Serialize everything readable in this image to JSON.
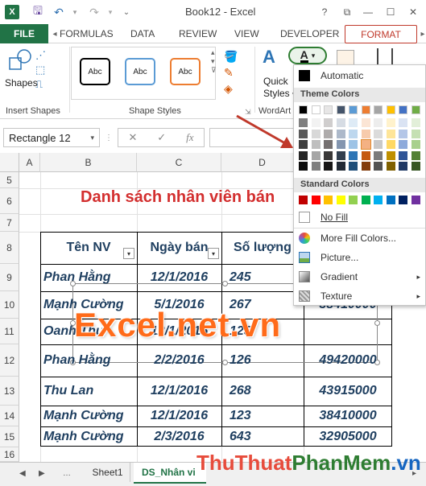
{
  "window": {
    "title": "Book12 - Excel",
    "help": "?",
    "restore": "⧉",
    "minimize": "—",
    "maximize": "☐",
    "close": "✕"
  },
  "quick_access": {
    "save_icon": "save-icon",
    "undo_icon": "undo-icon",
    "redo_icon": "redo-icon"
  },
  "tabs": {
    "file": "FILE",
    "formulas": "FORMULAS",
    "data": "DATA",
    "review": "REVIEW",
    "view": "VIEW",
    "developer": "DEVELOPER",
    "format": "FORMAT"
  },
  "ribbon": {
    "shapes_label": "Shapes",
    "insert_shapes_label": "Insert Shapes",
    "shape_style_sample": "Abc",
    "shape_styles_label": "Shape Styles",
    "quick_styles_line1": "Quick",
    "quick_styles_line2": "Styles",
    "wordart_label": "WordArt",
    "text_fill_letter": "A",
    "colors": {
      "style1": "#000000",
      "style2": "#5b9bd5",
      "style3": "#ed7d31"
    }
  },
  "formula_bar": {
    "name_box": "Rectangle 12",
    "cancel": "✕",
    "enter": "✓",
    "fx": "fx"
  },
  "grid": {
    "columns": [
      "A",
      "B",
      "C",
      "D"
    ],
    "rows": [
      "5",
      "6",
      "7",
      "8",
      "9",
      "10",
      "11",
      "12",
      "13",
      "14",
      "15",
      "16"
    ],
    "title": "Danh sách nhân viên bán",
    "headers": [
      "Tên NV",
      "Ngày bán",
      "Số lượng"
    ],
    "data_rows": [
      {
        "name": "Phan Hằng",
        "date": "12/1/2016",
        "qty": "245",
        "amount": ""
      },
      {
        "name": "Mạnh Cường",
        "date": "5/1/2016",
        "qty": "267",
        "amount": "38410000"
      },
      {
        "name": "Oanh Thu",
        "date": "12/1/2016",
        "qty": "125",
        "amount": ""
      },
      {
        "name": "Phan Hằng",
        "date": "2/2/2016",
        "qty": "126",
        "amount": "49420000"
      },
      {
        "name": "Thu Lan",
        "date": "12/1/2016",
        "qty": "268",
        "amount": "43915000"
      },
      {
        "name": "Mạnh Cường",
        "date": "12/1/2016",
        "qty": "123",
        "amount": "38410000"
      },
      {
        "name": "Mạnh Cường",
        "date": "2/3/2016",
        "qty": "643",
        "amount": "32905000"
      }
    ]
  },
  "watermark": "Excel.net.vn",
  "dropdown": {
    "automatic": "Automatic",
    "theme_colors": "Theme Colors",
    "standard_colors": "Standard Colors",
    "no_fill": "No Fill",
    "more_fill": "More Fill Colors...",
    "picture": "Picture...",
    "gradient": "Gradient",
    "texture": "Texture",
    "theme_top": [
      "#000000",
      "#ffffff",
      "#e7e6e6",
      "#44546a",
      "#5b9bd5",
      "#ed7d31",
      "#a5a5a5",
      "#ffc000",
      "#4472c4",
      "#70ad47"
    ],
    "theme_shades": [
      [
        "#7f7f7f",
        "#f2f2f2",
        "#d0cece",
        "#d6dce4",
        "#deebf6",
        "#fbe5d5",
        "#ededed",
        "#fff2cc",
        "#dae3f3",
        "#e2efd9"
      ],
      [
        "#595959",
        "#d8d8d8",
        "#aeabab",
        "#adb9ca",
        "#bdd7ee",
        "#f7cbac",
        "#dbdbdb",
        "#fee599",
        "#b4c6e7",
        "#c5e0b3"
      ],
      [
        "#3f3f3f",
        "#bfbfbf",
        "#757070",
        "#8496b0",
        "#9dc3e6",
        "#f4b183",
        "#c9c9c9",
        "#ffd965",
        "#8eaadb",
        "#a8d08d"
      ],
      [
        "#262626",
        "#a5a5a5",
        "#3a3838",
        "#323f4f",
        "#2e75b5",
        "#c55a11",
        "#7b7b7b",
        "#bf9000",
        "#2f5496",
        "#538135"
      ],
      [
        "#0c0c0c",
        "#7f7f7f",
        "#171616",
        "#222a35",
        "#1e4e79",
        "#833c0b",
        "#525252",
        "#7f6000",
        "#1f3864",
        "#375623"
      ]
    ],
    "standard": [
      "#c00000",
      "#ff0000",
      "#ffc000",
      "#ffff00",
      "#92d050",
      "#00b050",
      "#00b0f0",
      "#0070c0",
      "#002060",
      "#7030a0"
    ]
  },
  "sheet_tabs": {
    "sheet1": "Sheet1",
    "active": "DS_Nhân vi"
  },
  "brand": {
    "part1": "Thu",
    "part2": "Thuat",
    "part3": "Phan",
    "part4": "Mem",
    "part5": ".vn"
  }
}
